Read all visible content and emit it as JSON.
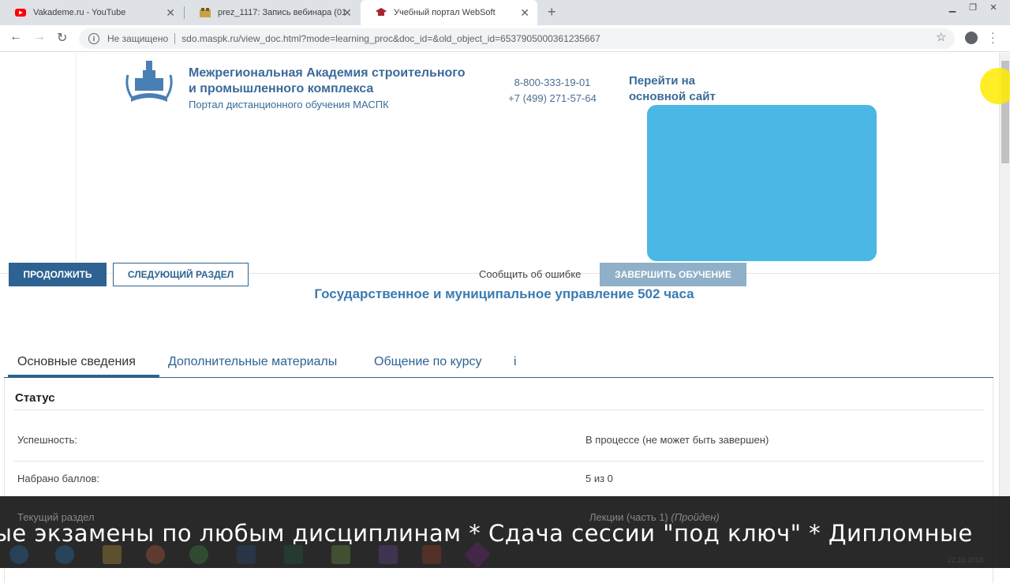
{
  "browser": {
    "tabs": [
      {
        "title": "Vakademe.ru - YouTube",
        "icon": "youtube-icon"
      },
      {
        "title": "prez_1117: Запись вебинара (01",
        "icon": "webinar-icon"
      },
      {
        "title": "Учебный портал WebSoft",
        "icon": "graduation-cap-icon",
        "active": true
      }
    ],
    "security_label": "Не защищено",
    "url": "sdo.maspk.ru/view_doc.html?mode=learning_proc&doc_id=&old_object_id=6537905000361235667"
  },
  "header": {
    "org_name_line1": "Межрегиональная Академия строительного",
    "org_name_line2": "и промышленного комплекса",
    "portal": "Портал дистанционного обучения МАСПК",
    "phone1": "8-800-333-19-01",
    "phone2": "+7 (499) 271-57-64",
    "go_main_line1": "Перейти на",
    "go_main_line2": "основной сайт",
    "banner_color": "#4bb7e5"
  },
  "course": {
    "title": "Государственное и муниципальное управление 502 часа"
  },
  "actions": {
    "continue": "ПРОДОЛЖИТЬ",
    "next_section": "СЛЕДУЮЩИЙ РАЗДЕЛ",
    "report_error": "Сообщить об ошибке",
    "finish": "ЗАВЕРШИТЬ ОБУЧЕНИЕ"
  },
  "content_tabs": [
    "Основные сведения",
    "Дополнительные материалы",
    "Общение по курсу",
    "i"
  ],
  "status": {
    "heading": "Статус",
    "rows": [
      {
        "label": "Успешность:",
        "value": "В процессе (не может быть завершен)"
      },
      {
        "label": "Набрано баллов:",
        "value": "5 из 0"
      },
      {
        "label": "Текущий раздел",
        "value": "Лекции (часть 1)",
        "note": "(Пройден)"
      }
    ]
  },
  "ticker": {
    "text": "ые экзамены по любым дисциплинам  *  Сдача сессии \"под ключ\"  *  Дипломные"
  },
  "system": {
    "date": "22.10.2018"
  },
  "colors": {
    "primary": "#2d6292",
    "title": "#3b7bb0",
    "finish": "#8fb0c8"
  }
}
